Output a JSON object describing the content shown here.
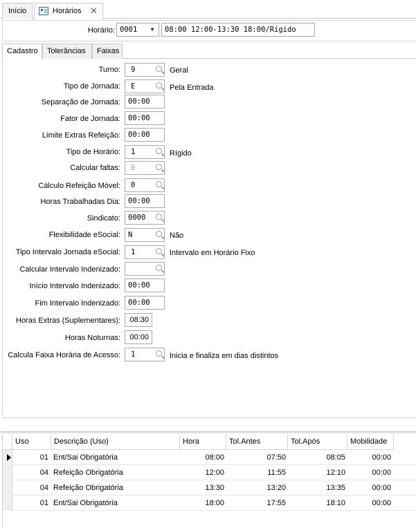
{
  "tabs": [
    {
      "label": "Início"
    },
    {
      "label": "Horários"
    }
  ],
  "horario": {
    "label": "Horário:",
    "code": "0001",
    "description": "08:00 12:00-13:30 18:00/Rígido"
  },
  "inner_tabs": [
    "Cadastro",
    "Tolerâncias",
    "Faixas"
  ],
  "form": {
    "turno": {
      "label": "Turno:",
      "value": "9",
      "desc": "Geral"
    },
    "tipo_jornada": {
      "label": "Tipo de Jornada:",
      "value": "E",
      "desc": "Pela Entrada"
    },
    "separacao_jornada": {
      "label": "Separação  de Jornada:",
      "value": "00:00"
    },
    "fator_jornada": {
      "label": "Fator de Jornada:",
      "value": "00:00"
    },
    "limite_extras": {
      "label": "Limite Extras Refeição:",
      "value": "00:00"
    },
    "tipo_horario": {
      "label": "Tipo de Horário:",
      "value": "1",
      "desc": "Rígido"
    },
    "calcular_faltas": {
      "label": "Calcular faltas:",
      "value": "0"
    },
    "calculo_refeicao": {
      "label": "Cálculo Refeição Móvel:",
      "value": "0"
    },
    "horas_trabalhadas": {
      "label": "Horas Trabalhadas Dia:",
      "value": "00:00"
    },
    "sindicato": {
      "label": "Sindicato:",
      "value": "0000"
    },
    "flexibilidade": {
      "label": "Flexibilidade eSocial:",
      "value": "N",
      "desc": "Não"
    },
    "tipo_intervalo": {
      "label": "Tipo Intervalo Jornada eSocial:",
      "value": "1",
      "desc": "Intervalo em Horário Fixo"
    },
    "calcular_intervalo": {
      "label": "Calcular Intervalo Indenizado:",
      "value": ""
    },
    "inicio_intervalo": {
      "label": "Início Intervalo Indenizado:",
      "value": "00:00"
    },
    "fim_intervalo": {
      "label": "Fim Intervalo Indenizado:",
      "value": "00:00"
    },
    "horas_extras": {
      "label": "Horas Extras (Suplementares):",
      "value": "08:30"
    },
    "horas_noturnas": {
      "label": "Horas Noturnas:",
      "value": "00:00"
    },
    "faixa_horaria": {
      "label": "Calcula Faixa Horária de Acesso:",
      "value": "1",
      "desc": "Inicia e finaliza em dias distintos"
    }
  },
  "grid": {
    "columns": [
      "Uso",
      "Descrição (Uso)",
      "Hora",
      "Tol.Antes",
      "Tol.Após",
      "Mobilidade"
    ],
    "rows": [
      {
        "uso": "01",
        "descricao": "Ent/Sai Obrigatória",
        "hora": "08:00",
        "tol_antes": "07:50",
        "tol_apos": "08:05",
        "mobilidade": "00:00"
      },
      {
        "uso": "04",
        "descricao": "Refeição Obrigatória",
        "hora": "12:00",
        "tol_antes": "11:55",
        "tol_apos": "12:10",
        "mobilidade": "00:00"
      },
      {
        "uso": "04",
        "descricao": "Refeição Obrigatória",
        "hora": "13:30",
        "tol_antes": "13:20",
        "tol_apos": "13:35",
        "mobilidade": "00:00"
      },
      {
        "uso": "01",
        "descricao": "Ent/Sai Obrigatória",
        "hora": "18:00",
        "tol_antes": "17:55",
        "tol_apos": "18:10",
        "mobilidade": "00:00"
      }
    ]
  },
  "icons": {
    "close": "close-x-icon",
    "lookup": "search-icon",
    "dropdown": "chevron-down-icon",
    "current_row": "row-pointer-icon"
  }
}
